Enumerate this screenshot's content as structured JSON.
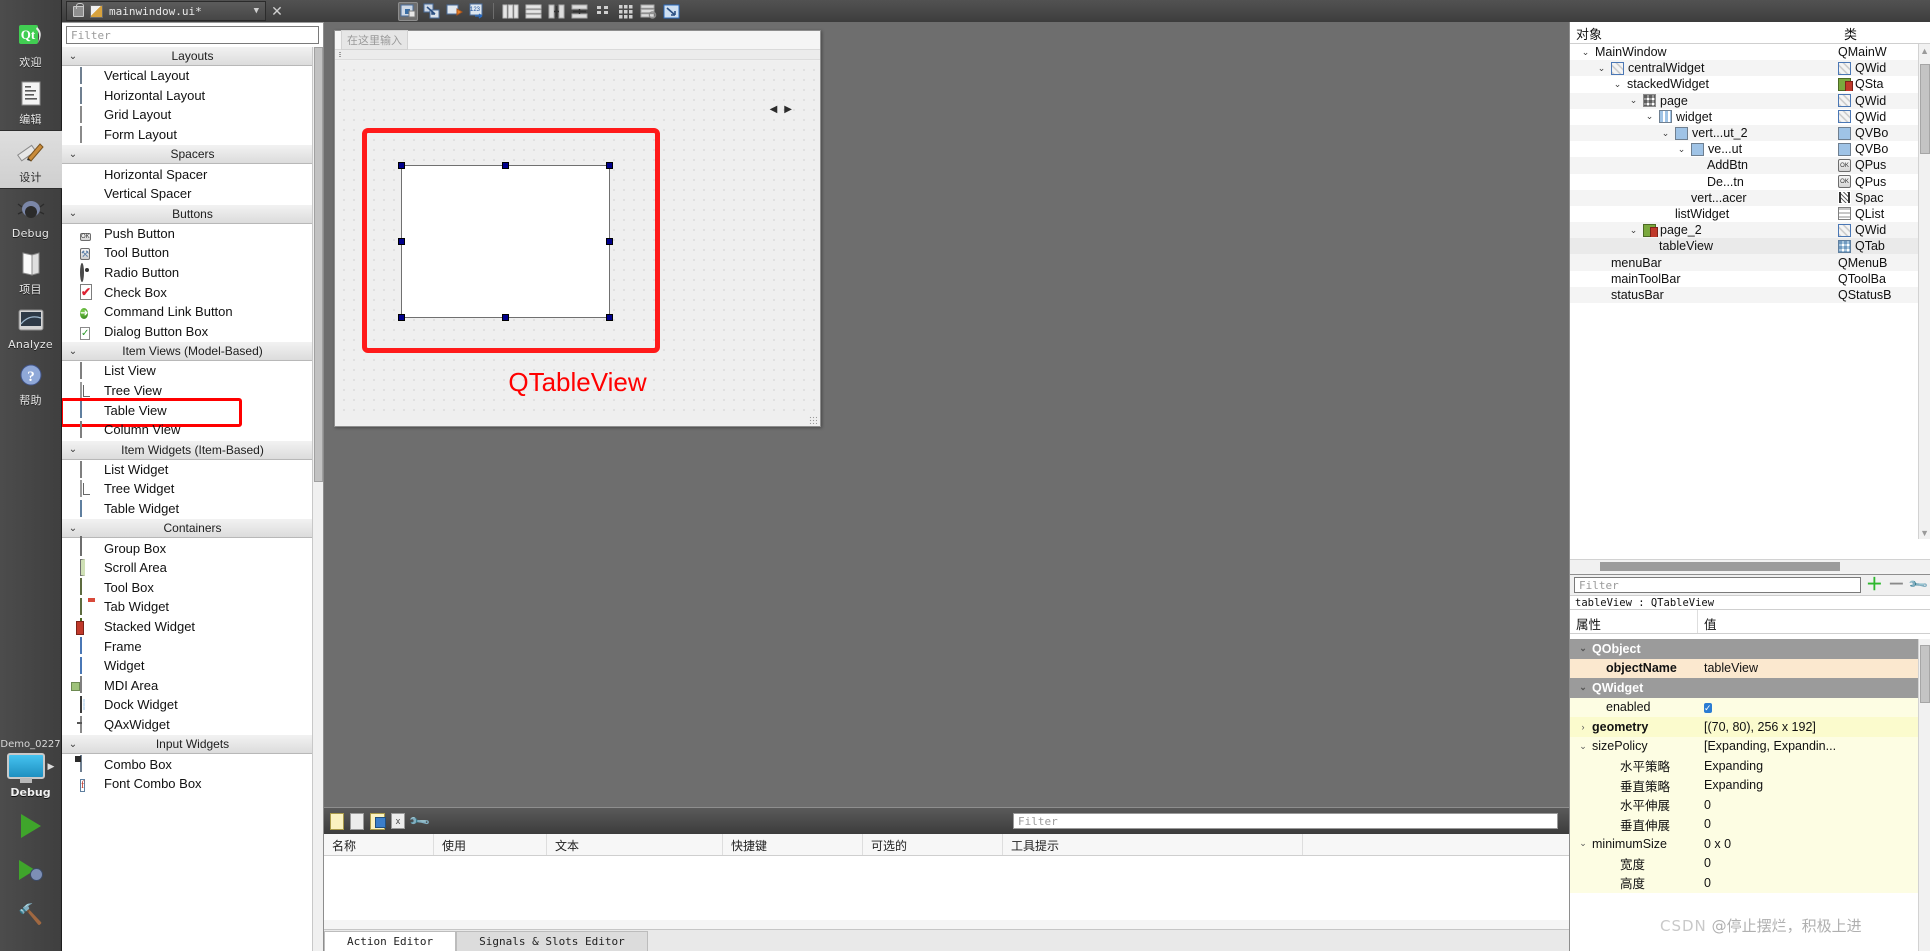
{
  "modebar": {
    "items": [
      {
        "label": "欢迎",
        "icon": "qt-logo-icon",
        "active": false
      },
      {
        "label": "编辑",
        "icon": "document-edit-icon",
        "active": false
      },
      {
        "label": "设计",
        "icon": "design-ruler-pencil-icon",
        "active": true
      },
      {
        "label": "Debug",
        "icon": "bug-icon",
        "active": false
      },
      {
        "label": "项目",
        "icon": "projects-folder-icon",
        "active": false
      },
      {
        "label": "Analyze",
        "icon": "analyze-graph-icon",
        "active": false
      },
      {
        "label": "帮助",
        "icon": "help-question-icon",
        "active": false
      }
    ],
    "kit": {
      "name": "Demo_0227",
      "build_config": "Debug"
    }
  },
  "doctab": {
    "filename": "mainwindow.ui*",
    "lock_icon": "unlock-icon",
    "file_icon": "ui-file-pencil-icon",
    "dropdown_icon": "chevron-down-icon",
    "close_icon": "close-x-icon"
  },
  "designer_toolbar": {
    "buttons": [
      {
        "name": "edit-widgets-icon",
        "title": "Edit Widgets"
      },
      {
        "name": "edit-signals-slots-icon",
        "title": "Edit Signals/Slots"
      },
      {
        "name": "edit-buddies-icon",
        "title": "Edit Buddies"
      },
      {
        "name": "edit-tab-order-icon",
        "title": "Edit Tab Order"
      },
      {
        "name": "layout-horizontally-icon",
        "title": "Lay Out Horizontally"
      },
      {
        "name": "layout-vertically-icon",
        "title": "Lay Out Vertically"
      },
      {
        "name": "layout-splitter-horizontal-icon",
        "title": "Lay Out Horizontally in Splitter"
      },
      {
        "name": "layout-splitter-vertical-icon",
        "title": "Lay Out Vertically in Splitter"
      },
      {
        "name": "layout-form-icon",
        "title": "Lay Out in a Form Layout"
      },
      {
        "name": "layout-grid-icon",
        "title": "Lay Out in a Grid"
      },
      {
        "name": "break-layout-icon",
        "title": "Break Layout"
      },
      {
        "name": "adjust-size-icon",
        "title": "Adjust Size"
      }
    ]
  },
  "widgetbox": {
    "filter_placeholder": "Filter",
    "categories": [
      {
        "name": "Layouts",
        "items": [
          {
            "label": "Vertical Layout",
            "icon": "vertical-layout-icon"
          },
          {
            "label": "Horizontal Layout",
            "icon": "horizontal-layout-icon"
          },
          {
            "label": "Grid Layout",
            "icon": "grid-layout-icon"
          },
          {
            "label": "Form Layout",
            "icon": "form-layout-icon"
          }
        ]
      },
      {
        "name": "Spacers",
        "items": [
          {
            "label": "Horizontal Spacer",
            "icon": "horizontal-spacer-icon"
          },
          {
            "label": "Vertical Spacer",
            "icon": "vertical-spacer-icon"
          }
        ]
      },
      {
        "name": "Buttons",
        "items": [
          {
            "label": "Push Button",
            "icon": "push-button-icon"
          },
          {
            "label": "Tool Button",
            "icon": "tool-button-icon"
          },
          {
            "label": "Radio Button",
            "icon": "radio-button-icon"
          },
          {
            "label": "Check Box",
            "icon": "check-box-icon"
          },
          {
            "label": "Command Link Button",
            "icon": "command-link-button-icon"
          },
          {
            "label": "Dialog Button Box",
            "icon": "dialog-button-box-icon"
          }
        ]
      },
      {
        "name": "Item Views (Model-Based)",
        "items": [
          {
            "label": "List View",
            "icon": "list-view-icon"
          },
          {
            "label": "Tree View",
            "icon": "tree-view-icon"
          },
          {
            "label": "Table View",
            "icon": "table-view-icon",
            "highlighted": true
          },
          {
            "label": "Column View",
            "icon": "column-view-icon"
          }
        ]
      },
      {
        "name": "Item Widgets (Item-Based)",
        "items": [
          {
            "label": "List Widget",
            "icon": "list-widget-icon"
          },
          {
            "label": "Tree Widget",
            "icon": "tree-widget-icon"
          },
          {
            "label": "Table Widget",
            "icon": "table-widget-icon"
          }
        ]
      },
      {
        "name": "Containers",
        "items": [
          {
            "label": "Group Box",
            "icon": "group-box-icon"
          },
          {
            "label": "Scroll Area",
            "icon": "scroll-area-icon"
          },
          {
            "label": "Tool Box",
            "icon": "tool-box-icon"
          },
          {
            "label": "Tab Widget",
            "icon": "tab-widget-icon"
          },
          {
            "label": "Stacked Widget",
            "icon": "stacked-widget-icon"
          },
          {
            "label": "Frame",
            "icon": "frame-icon"
          },
          {
            "label": "Widget",
            "icon": "widget-icon"
          },
          {
            "label": "MDI Area",
            "icon": "mdi-area-icon"
          },
          {
            "label": "Dock Widget",
            "icon": "dock-widget-icon"
          },
          {
            "label": "QAxWidget",
            "icon": "qax-widget-icon"
          }
        ]
      },
      {
        "name": "Input Widgets",
        "items": [
          {
            "label": "Combo Box",
            "icon": "combo-box-icon"
          },
          {
            "label": "Font Combo Box",
            "icon": "font-combo-box-icon"
          }
        ]
      }
    ]
  },
  "form": {
    "menu_placeholder": "在这里输入",
    "annotation_label": "QTableView",
    "annotation_color": "#ff0000",
    "nav_left_icon": "nav-left-arrow-icon",
    "nav_right_icon": "nav-right-arrow-icon"
  },
  "action_editor": {
    "toolbar": [
      {
        "name": "new-action-icon"
      },
      {
        "name": "copy-action-icon"
      },
      {
        "name": "edit-action-icon"
      },
      {
        "name": "delete-action-icon"
      },
      {
        "name": "configure-action-icon"
      }
    ],
    "filter_placeholder": "Filter",
    "columns": [
      "名称",
      "使用",
      "文本",
      "快捷键",
      "可选的",
      "工具提示"
    ],
    "rows": [],
    "tabs": [
      {
        "label": "Action Editor",
        "active": true
      },
      {
        "label": "Signals & Slots Editor",
        "active": false
      }
    ]
  },
  "object_inspector": {
    "columns": [
      "对象",
      "类"
    ],
    "rows": [
      {
        "indent": 0,
        "chevron": "v",
        "icon": "",
        "name": "MainWindow",
        "class": "QMainW",
        "class_icon": "",
        "selected": false
      },
      {
        "indent": 1,
        "chevron": "v",
        "icon": "widget-icon",
        "name": "centralWidget",
        "class": "QWid",
        "class_icon": "widget-icon",
        "selected": false
      },
      {
        "indent": 2,
        "chevron": "v",
        "icon": "",
        "name": "stackedWidget",
        "class": "QSta",
        "class_icon": "stacked-widget-icon",
        "selected": false
      },
      {
        "indent": 3,
        "chevron": "v",
        "icon": "grid-icon",
        "name": "page",
        "class": "QWid",
        "class_icon": "widget-icon",
        "selected": false
      },
      {
        "indent": 4,
        "chevron": "v",
        "icon": "horizontal-layout-icon",
        "name": "widget",
        "class": "QWid",
        "class_icon": "widget-icon",
        "selected": false
      },
      {
        "indent": 5,
        "chevron": "v",
        "icon": "vertical-layout-icon",
        "name": "vert...ut_2",
        "class": "QVBo",
        "class_icon": "vertical-layout-icon",
        "selected": false
      },
      {
        "indent": 6,
        "chevron": "v",
        "icon": "vertical-layout-icon",
        "name": "ve...ut",
        "class": "QVBo",
        "class_icon": "vertical-layout-icon",
        "selected": false
      },
      {
        "indent": 7,
        "chevron": "",
        "icon": "",
        "name": "AddBtn",
        "class": "QPus",
        "class_icon": "push-button-icon",
        "selected": false
      },
      {
        "indent": 7,
        "chevron": "",
        "icon": "",
        "name": "De...tn",
        "class": "QPus",
        "class_icon": "push-button-icon",
        "selected": false
      },
      {
        "indent": 6,
        "chevron": "",
        "icon": "",
        "name": "vert...acer",
        "class": "Spac",
        "class_icon": "horizontal-spacer-icon",
        "selected": false
      },
      {
        "indent": 5,
        "chevron": "",
        "icon": "",
        "name": "listWidget",
        "class": "QList",
        "class_icon": "list-widget-icon",
        "selected": false
      },
      {
        "indent": 3,
        "chevron": "v",
        "icon": "page-disabled-icon",
        "name": "page_2",
        "class": "QWid",
        "class_icon": "widget-icon",
        "selected": false
      },
      {
        "indent": 4,
        "chevron": "",
        "icon": "",
        "name": "tableView",
        "class": "QTab",
        "class_icon": "table-view-icon",
        "selected": true
      },
      {
        "indent": 1,
        "chevron": "",
        "icon": "",
        "name": "menuBar",
        "class": "QMenuB",
        "class_icon": "",
        "selected": false
      },
      {
        "indent": 1,
        "chevron": "",
        "icon": "",
        "name": "mainToolBar",
        "class": "QToolBa",
        "class_icon": "",
        "selected": false
      },
      {
        "indent": 1,
        "chevron": "",
        "icon": "",
        "name": "statusBar",
        "class": "QStatusB",
        "class_icon": "",
        "selected": false
      }
    ]
  },
  "property_editor": {
    "filter_placeholder": "Filter",
    "add_icon": "plus-icon",
    "remove_icon": "minus-icon",
    "configure_icon": "wrench-icon",
    "object_line": "tableView : QTableView",
    "columns": [
      "属性",
      "值"
    ],
    "rows": [
      {
        "kind": "group",
        "chevron": "v",
        "key": "QObject",
        "value": ""
      },
      {
        "kind": "tan",
        "chevron": "",
        "key": "objectName",
        "value": "tableView",
        "bold_key": true,
        "indent": 1
      },
      {
        "kind": "group",
        "chevron": "v",
        "key": "QWidget",
        "value": ""
      },
      {
        "kind": "lightyellow",
        "chevron": "",
        "key": "enabled",
        "value": "",
        "checkbox": true,
        "indent": 1
      },
      {
        "kind": "yellow",
        "chevron": ">",
        "key": "geometry",
        "value": "[(70, 80), 256 x 192]",
        "bold_key": true
      },
      {
        "kind": "lightyellow",
        "chevron": "v",
        "key": "sizePolicy",
        "value": "[Expanding, Expandin..."
      },
      {
        "kind": "lightyellow",
        "chevron": "",
        "key": "水平策略",
        "value": "Expanding",
        "indent": 2
      },
      {
        "kind": "lightyellow",
        "chevron": "",
        "key": "垂直策略",
        "value": "Expanding",
        "indent": 2
      },
      {
        "kind": "lightyellow",
        "chevron": "",
        "key": "水平伸展",
        "value": "0",
        "indent": 2
      },
      {
        "kind": "lightyellow",
        "chevron": "",
        "key": "垂直伸展",
        "value": "0",
        "indent": 2
      },
      {
        "kind": "lightyellow",
        "chevron": "v",
        "key": "minimumSize",
        "value": "0 x 0"
      },
      {
        "kind": "lightyellow",
        "chevron": "",
        "key": "宽度",
        "value": "0",
        "indent": 2
      },
      {
        "kind": "lightyellow",
        "chevron": "",
        "key": "高度",
        "value": "0",
        "indent": 2
      }
    ]
  },
  "watermark": {
    "prefix": "CSDN",
    "text": "@停止摆烂，积极上进"
  }
}
